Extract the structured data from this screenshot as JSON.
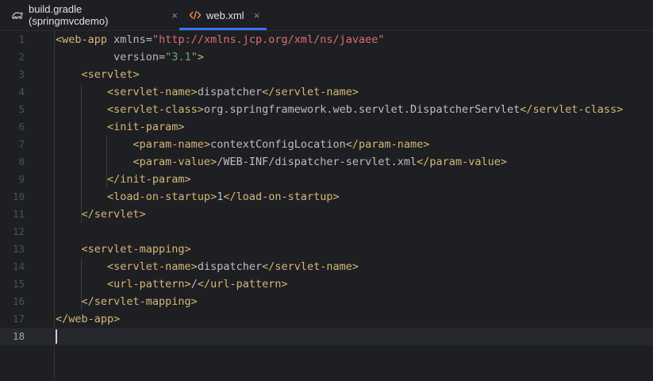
{
  "tabs": [
    {
      "label": "build.gradle (springmvcdemo)",
      "icon": "gradle-elephant-icon",
      "close": "×"
    },
    {
      "label": "web.xml",
      "icon": "xml-code-icon",
      "close": "×",
      "active": true
    }
  ],
  "editor": {
    "current_line": 18,
    "lines": [
      {
        "n": "1",
        "parts": [
          [
            "tag",
            "<web-app"
          ],
          [
            "attr",
            " xmlns"
          ],
          [
            "plain",
            "="
          ],
          [
            "url",
            "\"http://xmlns.jcp.org/xml/ns/javaee\""
          ]
        ]
      },
      {
        "n": "2",
        "parts": [
          [
            "attr",
            "         version"
          ],
          [
            "plain",
            "="
          ],
          [
            "str",
            "\"3.1\""
          ],
          [
            "tag",
            ">"
          ]
        ]
      },
      {
        "n": "3",
        "parts": [
          [
            "tag",
            "    <servlet>"
          ]
        ]
      },
      {
        "n": "4",
        "parts": [
          [
            "tag",
            "        <servlet-name>"
          ],
          [
            "plain",
            "dispatcher"
          ],
          [
            "tag",
            "</servlet-name>"
          ]
        ]
      },
      {
        "n": "5",
        "parts": [
          [
            "tag",
            "        <servlet-class>"
          ],
          [
            "plain",
            "org.springframework.web.servlet.DispatcherServlet"
          ],
          [
            "tag",
            "</servlet-class>"
          ]
        ]
      },
      {
        "n": "6",
        "parts": [
          [
            "tag",
            "        <init-param>"
          ]
        ]
      },
      {
        "n": "7",
        "parts": [
          [
            "tag",
            "            <param-name>"
          ],
          [
            "plain",
            "contextConfigLocation"
          ],
          [
            "tag",
            "</param-name>"
          ]
        ]
      },
      {
        "n": "8",
        "parts": [
          [
            "tag",
            "            <param-value>"
          ],
          [
            "plain",
            "/WEB-INF/dispatcher-servlet.xml"
          ],
          [
            "tag",
            "</param-value>"
          ]
        ]
      },
      {
        "n": "9",
        "parts": [
          [
            "tag",
            "        </init-param>"
          ]
        ]
      },
      {
        "n": "10",
        "parts": [
          [
            "tag",
            "        <load-on-startup>"
          ],
          [
            "plain",
            "1"
          ],
          [
            "tag",
            "</load-on-startup>"
          ]
        ]
      },
      {
        "n": "11",
        "parts": [
          [
            "tag",
            "    </servlet>"
          ]
        ]
      },
      {
        "n": "12",
        "parts": []
      },
      {
        "n": "13",
        "parts": [
          [
            "tag",
            "    <servlet-mapping>"
          ]
        ]
      },
      {
        "n": "14",
        "parts": [
          [
            "tag",
            "        <servlet-name>"
          ],
          [
            "plain",
            "dispatcher"
          ],
          [
            "tag",
            "</servlet-name>"
          ]
        ]
      },
      {
        "n": "15",
        "parts": [
          [
            "tag",
            "        <url-pattern>"
          ],
          [
            "plain",
            "/"
          ],
          [
            "tag",
            "</url-pattern>"
          ]
        ]
      },
      {
        "n": "16",
        "parts": [
          [
            "tag",
            "    </servlet-mapping>"
          ]
        ]
      },
      {
        "n": "17",
        "parts": [
          [
            "tag",
            "</web-app>"
          ]
        ]
      },
      {
        "n": "18",
        "parts": []
      }
    ]
  }
}
